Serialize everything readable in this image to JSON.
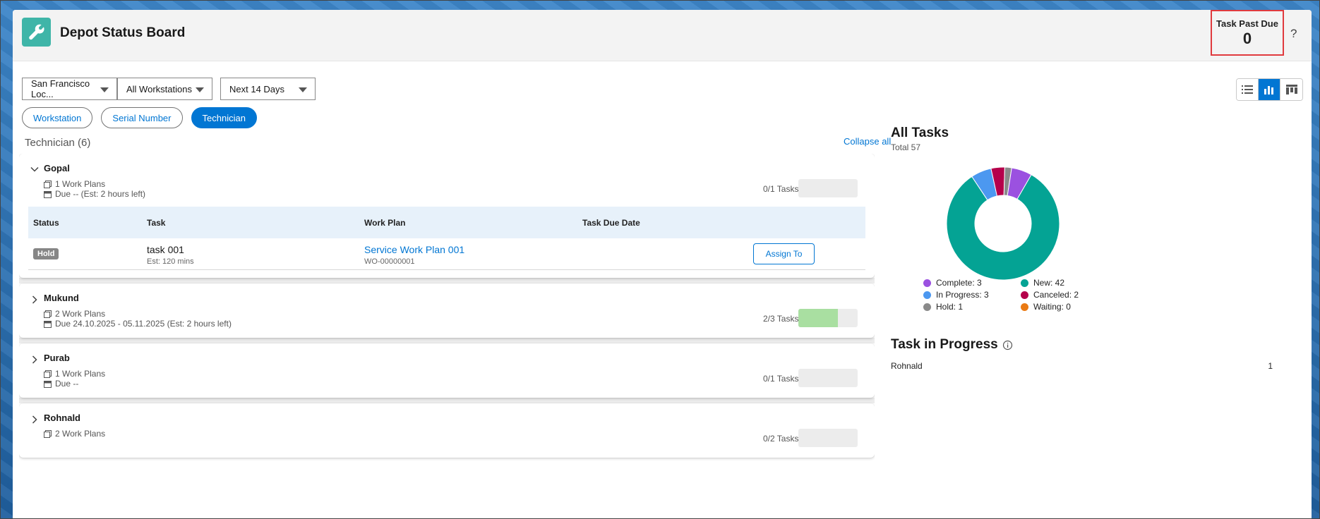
{
  "header": {
    "title": "Depot Status Board",
    "past_due_label": "Task Past Due",
    "past_due_value": "0",
    "help": "?"
  },
  "filters": {
    "location": "San Francisco Loc...",
    "workstation": "All Workstations",
    "range": "Next 14 Days"
  },
  "group_by": {
    "workstation": "Workstation",
    "serial": "Serial Number",
    "technician": "Technician"
  },
  "list": {
    "section_title": "Technician (6)",
    "collapse_all": "Collapse all",
    "columns": {
      "status": "Status",
      "task": "Task",
      "work_plan": "Work Plan",
      "due": "Task Due Date"
    },
    "technicians": [
      {
        "name": "Gopal",
        "work_plans": "1 Work Plans",
        "due": "Due -- (Est: 2 hours left)",
        "tasks": "0/1 Tasks",
        "progress": 0,
        "task": {
          "status": "Hold",
          "name": "task 001",
          "est": "Est: 120 mins",
          "work_plan": "Service Work Plan 001",
          "work_plan_number": "WO-00000001",
          "action": "Assign To"
        }
      },
      {
        "name": "Mukund",
        "work_plans": "2 Work Plans",
        "due": "Due 24.10.2025 - 05.11.2025 (Est: 2 hours left)",
        "tasks": "2/3 Tasks",
        "progress": 0.67
      },
      {
        "name": "Purab",
        "work_plans": "1 Work Plans",
        "due": "Due --",
        "tasks": "0/1 Tasks",
        "progress": 0
      },
      {
        "name": "Rohnald",
        "work_plans": "2 Work Plans",
        "tasks": "0/2 Tasks",
        "progress": 0
      }
    ]
  },
  "summary": {
    "title": "All Tasks",
    "total": "Total 57",
    "legend": {
      "complete": "Complete: 3",
      "new": "New: 42",
      "in_progress": "In Progress: 3",
      "canceled": "Canceled: 2",
      "hold": "Hold: 1",
      "waiting": "Waiting: 0"
    },
    "in_progress_title": "Task in Progress",
    "in_progress_rows": [
      {
        "name": "Rohnald",
        "count": "1"
      }
    ]
  },
  "chart_data": {
    "type": "pie",
    "categories": [
      "New",
      "In Progress",
      "Canceled",
      "Hold",
      "Complete",
      "Waiting"
    ],
    "values": [
      42,
      3,
      2,
      1,
      3,
      0
    ],
    "colors": [
      "#04a394",
      "#4c98f0",
      "#b5004b",
      "#8a8a8a",
      "#9b51e0",
      "#ea7a13"
    ],
    "title": "All Tasks",
    "donut": true
  },
  "colors": {
    "brand": "#0176d3",
    "app_icon": "#3fb5a8",
    "highlight": "#e03a3e"
  }
}
